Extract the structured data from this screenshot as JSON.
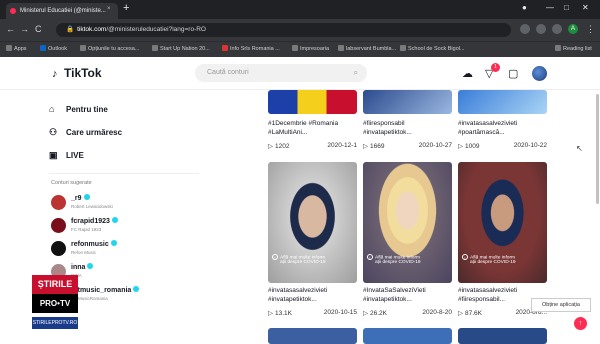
{
  "browser": {
    "tab_title": "Ministerul Educatiei (@ministe...",
    "tab_close": "×",
    "new_tab": "+",
    "url_prefix": "tiktok.com",
    "url_path": "/@ministeruleducatiei?lang=ro-RO",
    "nav": {
      "back": "←",
      "forward": "→",
      "reload": "C",
      "home": "⌂"
    },
    "window": {
      "min": "—",
      "max": "□",
      "close": "✕"
    },
    "avatar_letter": "A",
    "bookmarks": [
      "Apps",
      "Outlook",
      "Opțiunile tu accesa...",
      "Start Up Nation 20...",
      "Info Srls Romania ...",
      "Impresoaria",
      "labservant Bumbla...",
      "School de Sock Bigol...",
      "Reading list"
    ]
  },
  "tiktok": {
    "logo": "TikTok",
    "search_placeholder": "Caută conturi",
    "inbox_count": "1",
    "sidebar": {
      "for_you": "Pentru tine",
      "following": "Care urmăresc",
      "live": "LIVE",
      "suggested_title": "Conturi sugerate",
      "accounts": [
        {
          "name": "_r9",
          "sub": "Robert Lewandowski",
          "color": "#b33"
        },
        {
          "name": "fcrapid1923",
          "sub": "FC Rapid 1923",
          "color": "#7a0e1a"
        },
        {
          "name": "refonmusic",
          "sub": "Refon Music",
          "color": "#111"
        },
        {
          "name": "inna",
          "sub": "INNA",
          "color": "#a88"
        },
        {
          "name": "ratmusic_romania",
          "sub": "RatMusicRomania",
          "color": "#333"
        }
      ]
    },
    "videos_top": [
      {
        "caption1": "#1Decembrie #Romania",
        "caption2": "#LaMultiAni...",
        "views": "1202",
        "date": "2020-12-1"
      },
      {
        "caption1": "#fiiresponsabil",
        "caption2": "#invatapetiktok...",
        "views": "1669",
        "date": "2020-10-27"
      },
      {
        "caption1": "#invatasasalvezivieti",
        "caption2": "#poartămască...",
        "views": "1009",
        "date": "2020-10-22"
      }
    ],
    "videos_mid": [
      {
        "caption1": "#invatasasalvezivieti",
        "caption2": "#invatapetiktok...",
        "views": "13.1K",
        "date": "2020-10-15"
      },
      {
        "caption1": "#InvataSaSalveziVieti",
        "caption2": "#invatapetiktok...",
        "views": "26.2K",
        "date": "2020-8-20"
      },
      {
        "caption1": "#invatasasalvezivieti",
        "caption2": "#fiiresponsabil...",
        "views": "87.6K",
        "date": "2020-8ru..."
      }
    ],
    "covid_line1": "Află mai multe inform",
    "covid_line2": "ații despre COVID-19",
    "tooltip": "Obține aplicația",
    "play_glyph": "▷"
  },
  "watermark": {
    "top": "ȘTIRILE",
    "mid": "PRO•TV",
    "bot": "STIRILEPROTV.RO"
  },
  "colors": {
    "accent": "#fe2c55",
    "verified": "#20d5ec",
    "chrome_dark": "#202124",
    "chrome_bar": "#35363a"
  }
}
